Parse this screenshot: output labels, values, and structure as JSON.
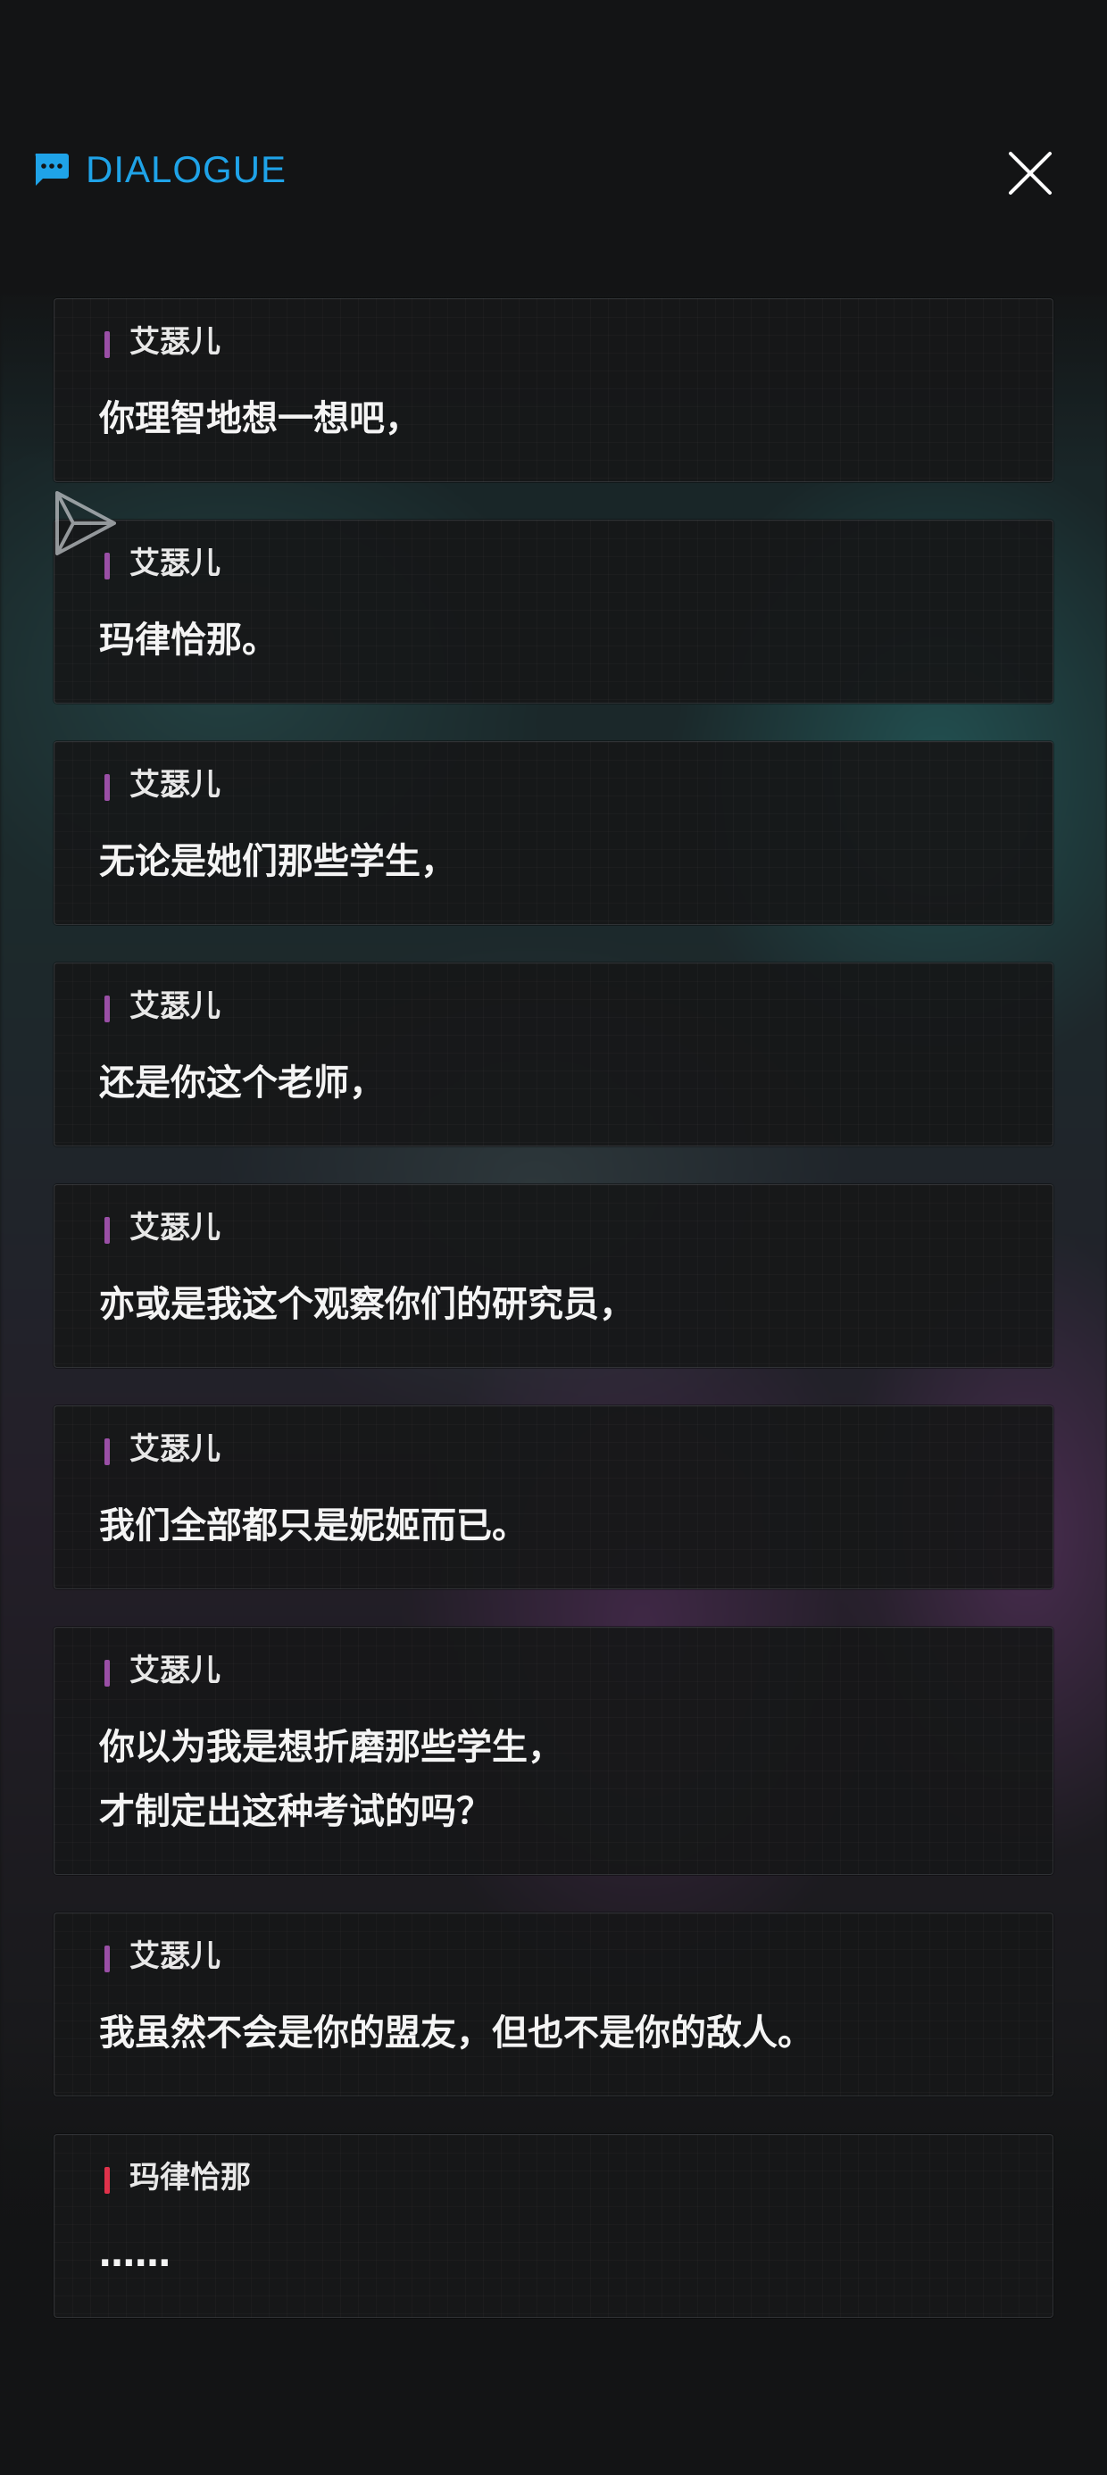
{
  "header": {
    "title": "DIALOGUE",
    "icon": "chat-icon",
    "close_icon": "close-icon",
    "accent_color": "#1fa3e8"
  },
  "overlay": {
    "icon": "send-icon"
  },
  "dialogue": [
    {
      "speaker": "艾瑟儿",
      "speaker_color": "#9a4fa6",
      "text": "你理智地想一想吧，"
    },
    {
      "speaker": "艾瑟儿",
      "speaker_color": "#9a4fa6",
      "text": "玛律恰那。"
    },
    {
      "speaker": "艾瑟儿",
      "speaker_color": "#9a4fa6",
      "text": "无论是她们那些学生，"
    },
    {
      "speaker": "艾瑟儿",
      "speaker_color": "#9a4fa6",
      "text": "还是你这个老师，"
    },
    {
      "speaker": "艾瑟儿",
      "speaker_color": "#9a4fa6",
      "text": "亦或是我这个观察你们的研究员，"
    },
    {
      "speaker": "艾瑟儿",
      "speaker_color": "#9a4fa6",
      "text": "我们全部都只是妮姬而已。"
    },
    {
      "speaker": "艾瑟儿",
      "speaker_color": "#9a4fa6",
      "text": "你以为我是想折磨那些学生，\n才制定出这种考试的吗？"
    },
    {
      "speaker": "艾瑟儿",
      "speaker_color": "#9a4fa6",
      "text": "我虽然不会是你的盟友，但也不是你的敌人。"
    },
    {
      "speaker": "玛律恰那",
      "speaker_color": "#e0324b",
      "text": "……"
    }
  ]
}
